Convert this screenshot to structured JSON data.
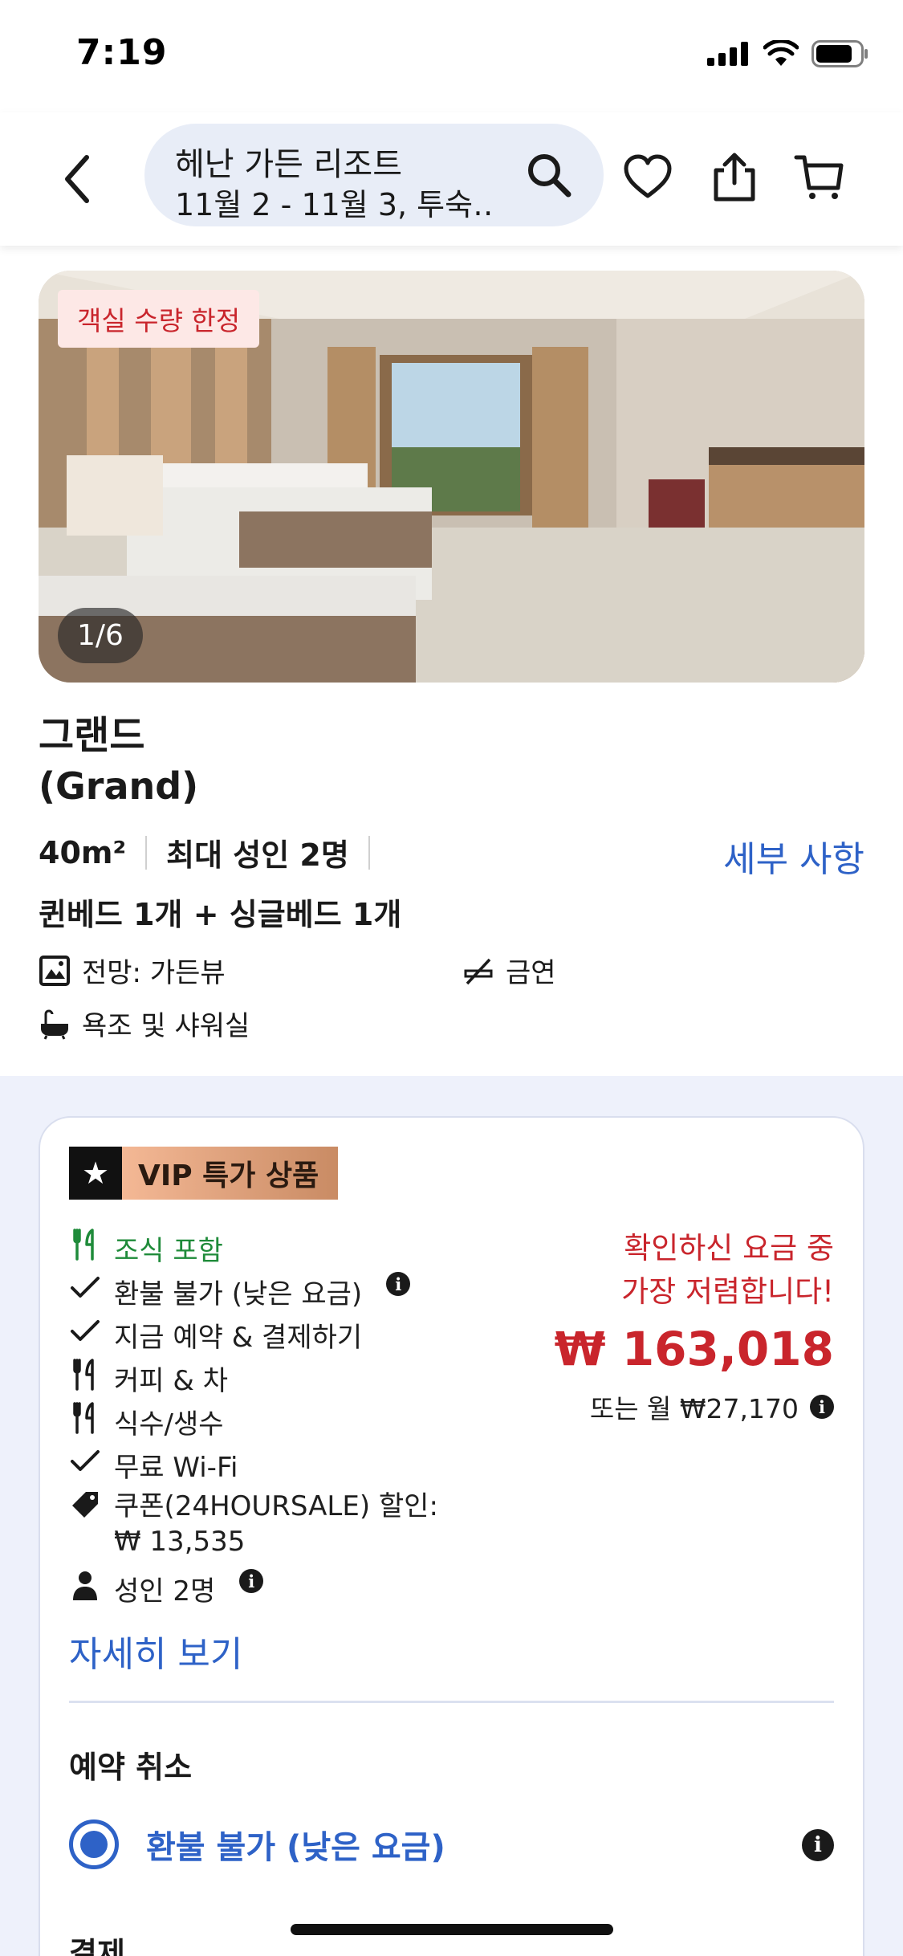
{
  "status_bar": {
    "time": "7:19"
  },
  "header": {
    "title": "헤난 가든 리조트",
    "subtitle": "11월 2 - 11월 3, 투숙…"
  },
  "photo": {
    "badge": "객실 수량 한정",
    "counter": "1/6"
  },
  "room": {
    "name_ko": "그랜드",
    "name_en": "(Grand)",
    "size": "40m²",
    "capacity": "최대 성인 2명",
    "details_link": "세부 사항",
    "beds": "퀸베드 1개 + 싱글베드 1개",
    "amenities": {
      "view": "전망: 가든뷰",
      "smoking": "금연",
      "bath": "욕조 및 샤워실"
    }
  },
  "offer": {
    "badge": "VIP 특가 상품",
    "features": {
      "breakfast": "조식 포함",
      "refund": "환불 불가 (낮은 요금)",
      "pay_now": "지금 예약 & 결제하기",
      "coffee": "커피 & 차",
      "water": "식수/생수",
      "wifi": "무료 Wi-Fi",
      "coupon_line1": "쿠폰(24HOURSALE) 할인:",
      "coupon_line2": "₩ 13,535",
      "adults": "성인 2명"
    },
    "price_note_line1": "확인하신 요금 중",
    "price_note_line2": "가장 저렴합니다!",
    "price": "₩ 163,018",
    "monthly": "또는 월 ₩27,170",
    "more_link": "자세히 보기",
    "cancel_title": "예약 취소",
    "cancel_option": "환불 불가 (낮은 요금)",
    "payment_title": "결제"
  },
  "colors": {
    "accent_blue": "#2e62c7",
    "price_red": "#c9252c",
    "feature_green": "#1f8b3a",
    "page_gray": "#eef1fb"
  }
}
